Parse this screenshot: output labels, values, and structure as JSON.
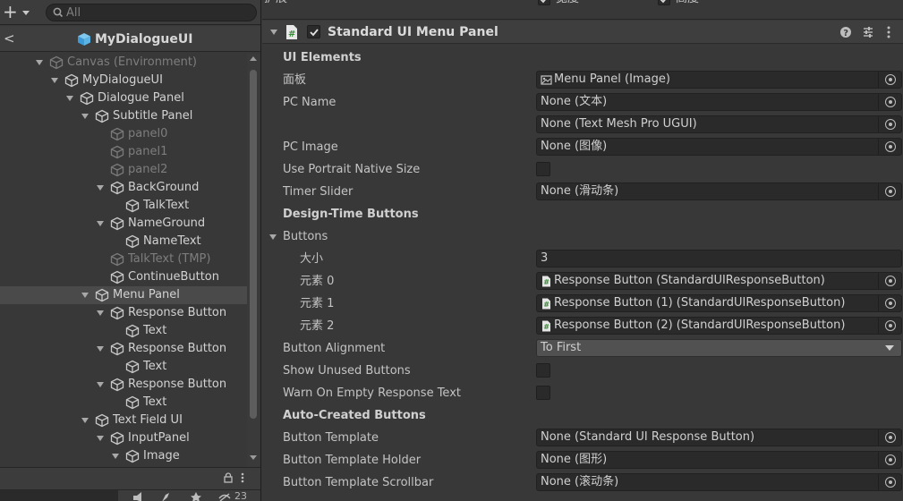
{
  "hierarchy": {
    "search_placeholder": "All",
    "prefab_title": "MyDialogueUI",
    "items": [
      {
        "label": "Canvas (Environment)",
        "depth": 0,
        "fold": true,
        "dim": true,
        "icon": "cube-outline-icon"
      },
      {
        "label": "MyDialogueUI",
        "depth": 1,
        "fold": true,
        "dim": false,
        "icon": "cube-outline-icon"
      },
      {
        "label": "Dialogue Panel",
        "depth": 2,
        "fold": true,
        "dim": false,
        "icon": "cube-outline-icon"
      },
      {
        "label": "Subtitle Panel",
        "depth": 3,
        "fold": true,
        "dim": false,
        "icon": "cube-outline-icon"
      },
      {
        "label": "panel0",
        "depth": 4,
        "fold": false,
        "dim": true,
        "icon": "cube-outline-icon"
      },
      {
        "label": "panel1",
        "depth": 4,
        "fold": false,
        "dim": true,
        "icon": "cube-outline-icon"
      },
      {
        "label": "panel2",
        "depth": 4,
        "fold": false,
        "dim": true,
        "icon": "cube-outline-icon"
      },
      {
        "label": "BackGround",
        "depth": 4,
        "fold": true,
        "dim": false,
        "icon": "cube-outline-icon"
      },
      {
        "label": "TalkText",
        "depth": 5,
        "fold": false,
        "dim": false,
        "icon": "cube-outline-icon"
      },
      {
        "label": "NameGround",
        "depth": 4,
        "fold": true,
        "dim": false,
        "icon": "cube-outline-icon"
      },
      {
        "label": "NameText",
        "depth": 5,
        "fold": false,
        "dim": false,
        "icon": "cube-outline-icon"
      },
      {
        "label": "TalkText (TMP)",
        "depth": 4,
        "fold": false,
        "dim": true,
        "icon": "cube-outline-icon"
      },
      {
        "label": "ContinueButton",
        "depth": 4,
        "fold": false,
        "dim": false,
        "icon": "cube-outline-icon"
      },
      {
        "label": "Menu Panel",
        "depth": 3,
        "fold": true,
        "dim": false,
        "selected": true,
        "icon": "cube-outline-icon"
      },
      {
        "label": "Response Button",
        "depth": 4,
        "fold": true,
        "dim": false,
        "icon": "cube-outline-icon"
      },
      {
        "label": "Text",
        "depth": 5,
        "fold": false,
        "dim": false,
        "icon": "cube-outline-icon"
      },
      {
        "label": "Response Button",
        "depth": 4,
        "fold": true,
        "dim": false,
        "icon": "cube-outline-icon"
      },
      {
        "label": "Text",
        "depth": 5,
        "fold": false,
        "dim": false,
        "icon": "cube-outline-icon"
      },
      {
        "label": "Response Button",
        "depth": 4,
        "fold": true,
        "dim": false,
        "icon": "cube-outline-icon"
      },
      {
        "label": "Text",
        "depth": 5,
        "fold": false,
        "dim": false,
        "icon": "cube-outline-icon"
      },
      {
        "label": "Text Field UI",
        "depth": 3,
        "fold": true,
        "dim": false,
        "icon": "cube-outline-icon"
      },
      {
        "label": "InputPanel",
        "depth": 4,
        "fold": true,
        "dim": false,
        "icon": "cube-outline-icon"
      },
      {
        "label": "Image",
        "depth": 5,
        "fold": true,
        "dim": false,
        "icon": "cube-outline-icon"
      }
    ],
    "bottom_count": "23"
  },
  "inspector": {
    "prev_section": {
      "left_label": "扩展",
      "right_label": "高度"
    },
    "component_title": "Standard UI Menu Panel",
    "rows": [
      {
        "kind": "header",
        "label": "UI Elements"
      },
      {
        "kind": "object",
        "label": "面板",
        "value": "Menu Panel (Image)",
        "icon": "image-icon"
      },
      {
        "kind": "object",
        "label": "PC Name",
        "value": "None (文本)"
      },
      {
        "kind": "object",
        "label": "",
        "value": "None (Text Mesh Pro UGUI)"
      },
      {
        "kind": "object",
        "label": "PC Image",
        "value": "None (图像)"
      },
      {
        "kind": "checkbox",
        "label": "Use Portrait Native Size"
      },
      {
        "kind": "object",
        "label": "Timer Slider",
        "value": "None (滑动条)"
      },
      {
        "kind": "header",
        "label": "Design-Time Buttons"
      },
      {
        "kind": "foldout",
        "label": "Buttons"
      },
      {
        "kind": "text",
        "label": "大小",
        "value": "3",
        "indent": true
      },
      {
        "kind": "object",
        "label": "元素 0",
        "value": "Response Button (StandardUIResponseButton)",
        "icon": "script-icon",
        "indent": true
      },
      {
        "kind": "object",
        "label": "元素 1",
        "value": "Response Button (1) (StandardUIResponseButton)",
        "icon": "script-icon",
        "indent": true
      },
      {
        "kind": "object",
        "label": "元素 2",
        "value": "Response Button (2) (StandardUIResponseButton)",
        "icon": "script-icon",
        "indent": true
      },
      {
        "kind": "dropdown",
        "label": "Button Alignment",
        "value": "To First"
      },
      {
        "kind": "checkbox",
        "label": "Show Unused Buttons"
      },
      {
        "kind": "checkbox",
        "label": "Warn On Empty Response Text"
      },
      {
        "kind": "header",
        "label": "Auto-Created Buttons"
      },
      {
        "kind": "object",
        "label": "Button Template",
        "value": "None (Standard UI Response Button)"
      },
      {
        "kind": "object",
        "label": "Button Template Holder",
        "value": "None (图形)"
      },
      {
        "kind": "object",
        "label": "Button Template Scrollbar",
        "value": "None (滚动条)"
      }
    ]
  },
  "colors": {
    "panel_bg": "#383838",
    "field_bg": "#2a2a2a",
    "selected_row": "#4a4a4a",
    "text": "#c4c4c4"
  }
}
